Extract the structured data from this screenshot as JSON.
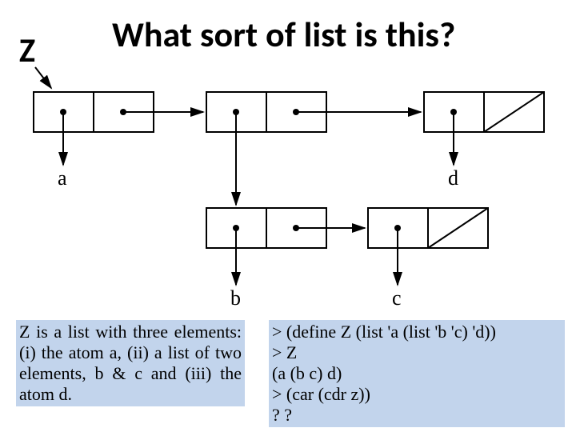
{
  "z_label": "Z",
  "title": "What sort of list is this?",
  "atom_a": "a",
  "atom_b": "b",
  "atom_c": "c",
  "atom_d": "d",
  "desc_left": "Z is a list with three elements: (i) the atom a, (ii) a list of two elements, b & c and (iii) the atom d.",
  "desc_right_1": "> (define  Z  (list  'a  (list  'b 'c)  'd))",
  "desc_right_2": "> Z",
  "desc_right_3": "(a  (b c)  d)",
  "desc_right_4": "> (car (cdr z))",
  "desc_right_5": "? ?",
  "chart_data": {
    "type": "diagram",
    "structure": "box-and-pointer list diagram",
    "expression": "(a (b c) d)",
    "top_level_cells": 3,
    "top_level": [
      {
        "car": "a",
        "cdr": "next"
      },
      {
        "car": "(b c)",
        "cdr": "next"
      },
      {
        "car": "d",
        "cdr": "nil"
      }
    ],
    "nested_list": [
      {
        "car": "b",
        "cdr": "next"
      },
      {
        "car": "c",
        "cdr": "nil"
      }
    ]
  }
}
